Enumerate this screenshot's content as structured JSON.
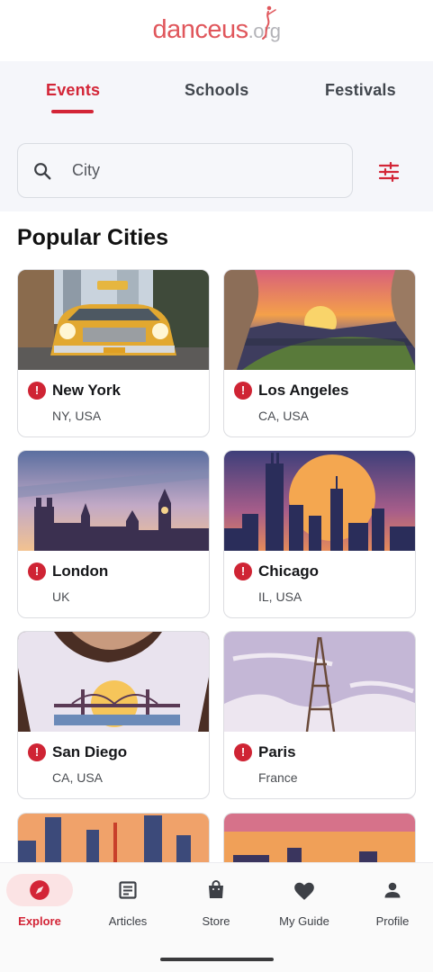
{
  "brand": {
    "name_main": "danceus",
    "name_tld": ".org"
  },
  "tabs": [
    {
      "label": "Events",
      "active": true
    },
    {
      "label": "Schools",
      "active": false
    },
    {
      "label": "Festivals",
      "active": false
    }
  ],
  "search": {
    "placeholder": "City",
    "value": ""
  },
  "filter_icon": "tune-icon",
  "section_title": "Popular Cities",
  "cities": [
    {
      "name": "New York",
      "region": "NY, USA",
      "image": "taxi-illustration"
    },
    {
      "name": "Los Angeles",
      "region": "CA, USA",
      "image": "hollywood-sunset-illustration"
    },
    {
      "name": "London",
      "region": "UK",
      "image": "london-skyline-illustration"
    },
    {
      "name": "Chicago",
      "region": "IL, USA",
      "image": "chicago-skyline-illustration"
    },
    {
      "name": "San Diego",
      "region": "CA, USA",
      "image": "bridge-shirt-photo"
    },
    {
      "name": "Paris",
      "region": "France",
      "image": "eiffel-tower-illustration"
    }
  ],
  "nav": [
    {
      "label": "Explore",
      "icon": "compass-icon",
      "active": true
    },
    {
      "label": "Articles",
      "icon": "article-icon",
      "active": false
    },
    {
      "label": "Store",
      "icon": "shopping-bag-icon",
      "active": false
    },
    {
      "label": "My Guide",
      "icon": "heart-icon",
      "active": false
    },
    {
      "label": "Profile",
      "icon": "person-icon",
      "active": false
    }
  ],
  "colors": {
    "accent": "#d32537",
    "panel_bg": "#f5f6fa",
    "nav_active_bg": "#fbe3e4"
  }
}
